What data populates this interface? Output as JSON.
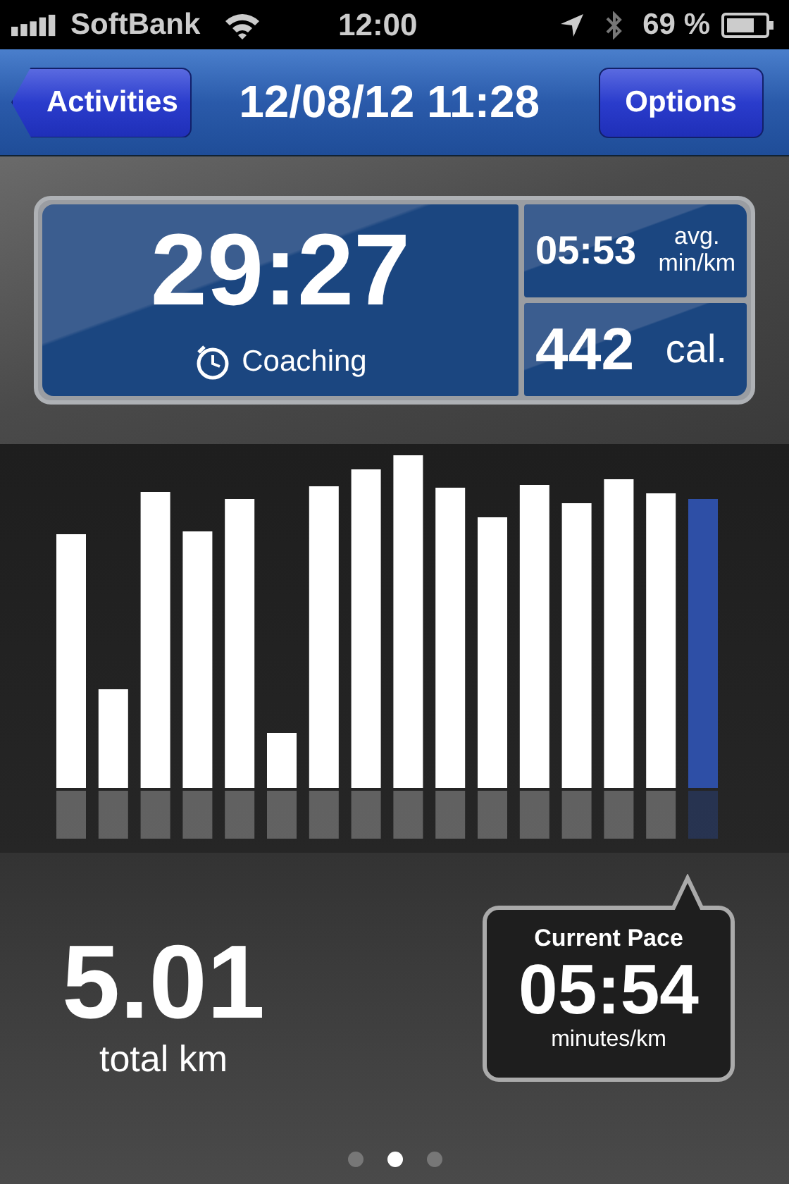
{
  "status_bar": {
    "carrier": "SoftBank",
    "time": "12:00",
    "battery": "69 %"
  },
  "nav_bar": {
    "back_button": "Activities",
    "title": "12/08/12 11:28",
    "right_button": "Options"
  },
  "summary": {
    "duration": "29:27",
    "coaching": "Coaching",
    "avg_pace": "05:53",
    "avg_pace_units": [
      "avg.",
      "min/km"
    ],
    "calories": "442",
    "calories_unit": "cal."
  },
  "distance": {
    "value": "5.01",
    "label": "total km"
  },
  "current_pace": {
    "title": "Current Pace",
    "value": "05:54",
    "unit": "minutes/km"
  },
  "page_dots": [
    {
      "selected": false
    },
    {
      "selected": true
    },
    {
      "selected": false
    }
  ]
}
